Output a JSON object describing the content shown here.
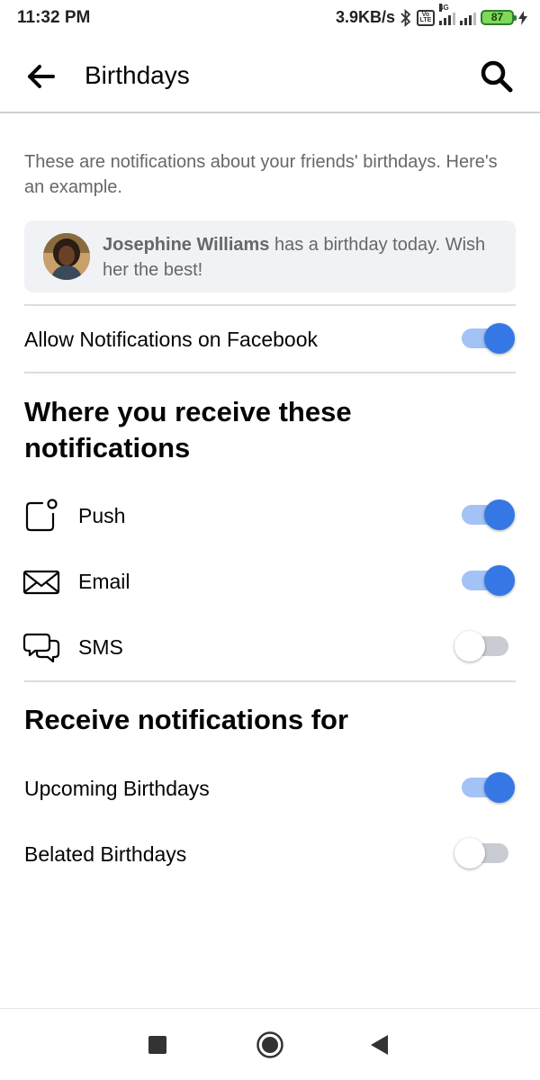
{
  "status_bar": {
    "time": "11:32 PM",
    "net_speed": "3.9KB/s",
    "network_type": "4G",
    "volte_label": "Vo LTE",
    "battery_level": "87"
  },
  "header": {
    "title": "Birthdays"
  },
  "description": "These are notifications about your friends' birthdays. Here's an example.",
  "example": {
    "name": "Josephine Williams",
    "message": " has a birthday today. Wish her the best!"
  },
  "allow": {
    "label": "Allow Notifications on Facebook",
    "enabled": true
  },
  "where_section": {
    "heading": "Where you receive these notifications",
    "items": [
      {
        "label": "Push",
        "icon": "push-icon",
        "enabled": true
      },
      {
        "label": "Email",
        "icon": "email-icon",
        "enabled": true
      },
      {
        "label": "SMS",
        "icon": "sms-icon",
        "enabled": false
      }
    ]
  },
  "for_section": {
    "heading": "Receive notifications for",
    "items": [
      {
        "label": "Upcoming Birthdays",
        "enabled": true
      },
      {
        "label": "Belated Birthdays",
        "enabled": false
      }
    ]
  },
  "colors": {
    "accent": "#3578e5",
    "toggle_on_track": "#a3c2f5",
    "toggle_off_track": "#c9ccd1",
    "secondary_text": "#65676b"
  }
}
